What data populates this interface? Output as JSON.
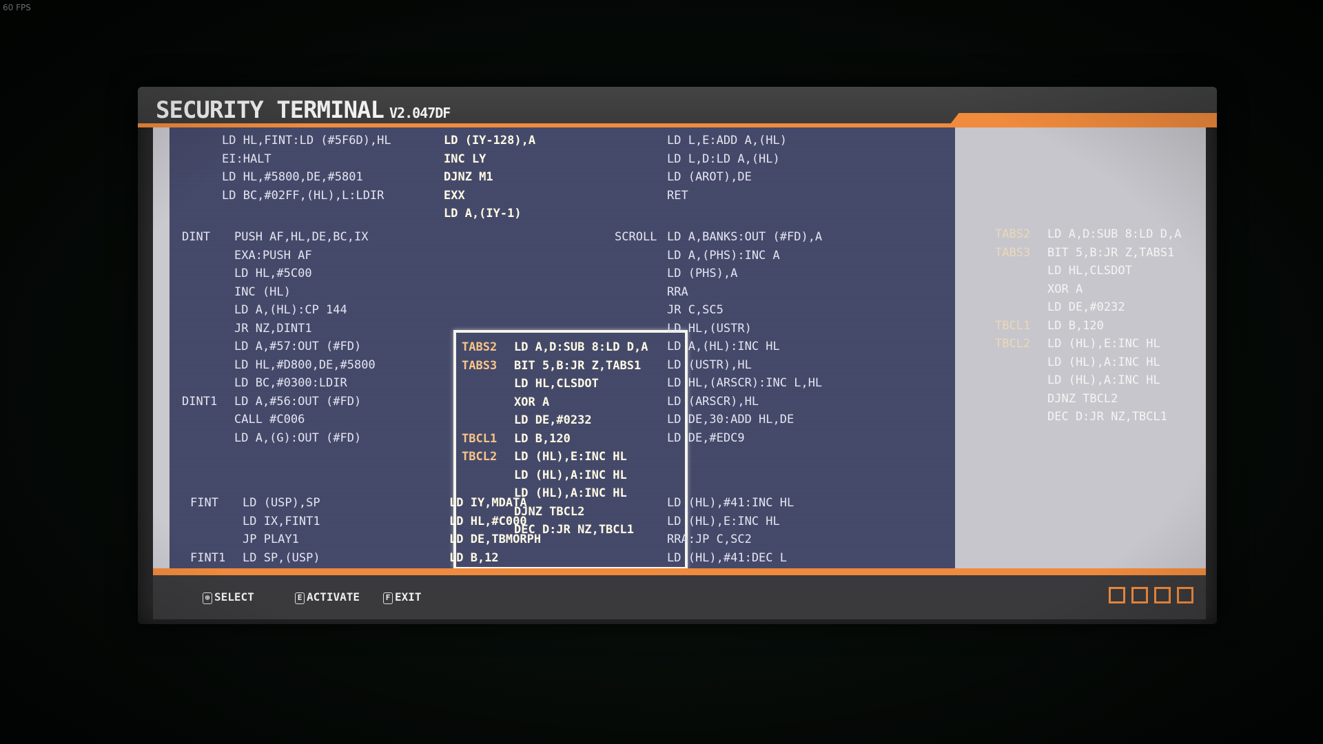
{
  "fps": "60 FPS",
  "title": "SECURITY TERMINAL",
  "version": "V2.047DF",
  "code": {
    "col1_top": [
      "LD HL,FINT:LD (#5F6D),HL",
      "EI:HALT",
      "LD HL,#5800,DE,#5801",
      "LD BC,#02FF,(HL),L:LDIR"
    ],
    "col1_mid": [
      {
        "label": "DINT",
        "text": "PUSH AF,HL,DE,BC,IX"
      },
      {
        "label": "",
        "text": "EXA:PUSH AF"
      },
      {
        "label": "",
        "text": "LD HL,#5C00"
      },
      {
        "label": "",
        "text": "INC (HL)"
      },
      {
        "label": "",
        "text": "LD A,(HL):CP 144"
      },
      {
        "label": "",
        "text": "JR NZ,DINT1"
      },
      {
        "label": "",
        "text": "LD A,#57:OUT (#FD)"
      },
      {
        "label": "",
        "text": "LD HL,#D800,DE,#5800"
      },
      {
        "label": "",
        "text": "LD BC,#0300:LDIR"
      },
      {
        "label": "DINT1",
        "text": "LD A,#56:OUT (#FD)"
      },
      {
        "label": "",
        "text": "CALL #C006"
      },
      {
        "label": "",
        "text": "LD A,(G):OUT (#FD)"
      }
    ],
    "col1_bot": [
      {
        "label": "FINT",
        "text": "LD (USP),SP"
      },
      {
        "label": "",
        "text": "LD IX,FINT1"
      },
      {
        "label": "",
        "text": "JP PLAY1"
      },
      {
        "label": "FINT1",
        "text": "LD SP,(USP)"
      }
    ],
    "col2_top": [
      "LD (IY-128),A",
      "INC LY",
      "DJNZ M1",
      "EXX",
      "LD A,(IY-1)"
    ],
    "col2_mid": [
      {
        "label": "TABS2",
        "text": "LD A,D:SUB 8:LD D,A"
      },
      {
        "label": "TABS3",
        "text": "BIT 5,B:JR Z,TABS1"
      },
      {
        "label": "",
        "text": "LD HL,CLSDOT"
      },
      {
        "label": "",
        "text": "XOR A"
      },
      {
        "label": "",
        "text": "LD DE,#0232"
      },
      {
        "label": "TBCL1",
        "text": "LD B,120"
      },
      {
        "label": "TBCL2",
        "text": "LD (HL),E:INC HL"
      },
      {
        "label": "",
        "text": "LD (HL),A:INC HL"
      },
      {
        "label": "",
        "text": "LD (HL),A:INC HL"
      },
      {
        "label": "",
        "text": "DJNZ TBCL2"
      },
      {
        "label": "",
        "text": "DEC D:JR NZ,TBCL1"
      }
    ],
    "col2_bot": [
      "LD IY,MDATA",
      "LD HL,#C000",
      "LD DE,TBMORPH",
      "LD B,12"
    ],
    "col3_top": [
      "LD L,E:ADD A,(HL)",
      "LD L,D:LD A,(HL)",
      "LD (AROT),DE",
      "RET"
    ],
    "col3_mid": [
      {
        "label": "SCROLL",
        "text": "LD A,BANKS:OUT (#FD),A"
      },
      {
        "label": "",
        "text": "LD A,(PHS):INC A"
      },
      {
        "label": "",
        "text": "LD (PHS),A"
      },
      {
        "label": "",
        "text": "RRA"
      },
      {
        "label": "",
        "text": "JR C,SC5"
      },
      {
        "label": "",
        "text": "LD HL,(USTR)"
      },
      {
        "label": "",
        "text": "LD A,(HL):INC HL"
      },
      {
        "label": "",
        "text": "LD (USTR),HL"
      },
      {
        "label": "",
        "text": "LD HL,(ARSCR):INC L,HL"
      },
      {
        "label": "",
        "text": "LD (ARSCR),HL"
      },
      {
        "label": "",
        "text": "LD DE,30:ADD HL,DE"
      },
      {
        "label": "",
        "text": "LD DE,#EDC9"
      }
    ],
    "col3_bot": [
      "LD (HL),#41:INC HL",
      "LD (HL),E:INC HL",
      "RRA:JP C,SC2",
      "LD (HL),#41:DEC L"
    ]
  },
  "right_panel": [
    {
      "label": "TABS2",
      "text": "LD A,D:SUB 8:LD D,A"
    },
    {
      "label": "TABS3",
      "text": "BIT 5,B:JR Z,TABS1"
    },
    {
      "label": "",
      "text": "LD HL,CLSDOT"
    },
    {
      "label": "",
      "text": "XOR A"
    },
    {
      "label": "",
      "text": "LD DE,#0232"
    },
    {
      "label": "TBCL1",
      "text": "LD B,120"
    },
    {
      "label": "TBCL2",
      "text": "LD (HL),E:INC HL"
    },
    {
      "label": "",
      "text": "LD (HL),A:INC HL"
    },
    {
      "label": "",
      "text": "LD (HL),A:INC HL"
    },
    {
      "label": "",
      "text": "DJNZ TBCL2"
    },
    {
      "label": "",
      "text": "DEC D:JR NZ,TBCL1"
    }
  ],
  "footer": {
    "select": "SELECT",
    "activate": "ACTIVATE",
    "exit": "EXIT",
    "select_key": "⊕",
    "activate_key": "E",
    "exit_key": "F"
  },
  "colors": {
    "accent": "#f08a3c",
    "panel": "#444868",
    "side": "#c6c6cc"
  },
  "indicator_count": 4
}
